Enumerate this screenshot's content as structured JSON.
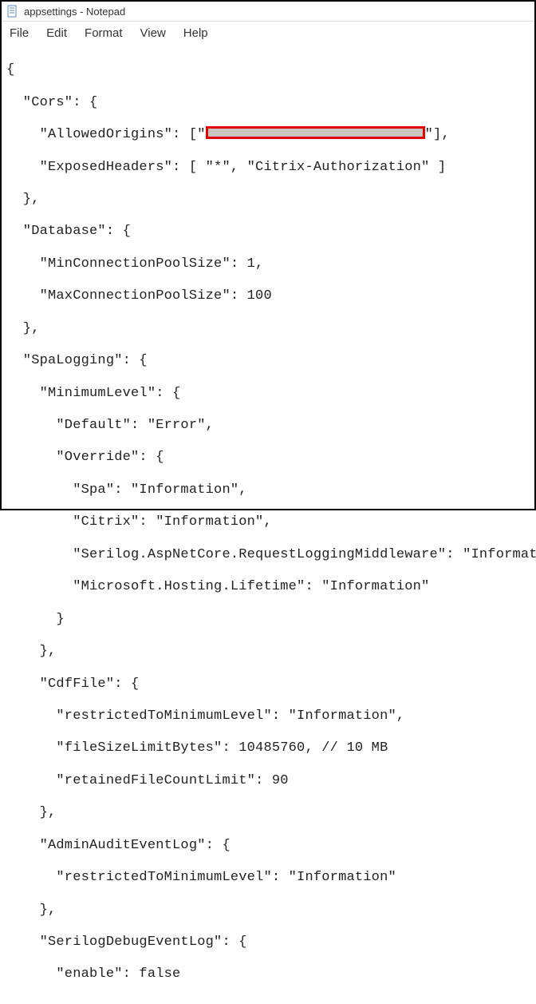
{
  "window": {
    "title": "appsettings - Notepad"
  },
  "menu": {
    "file": "File",
    "edit": "Edit",
    "format": "Format",
    "view": "View",
    "help": "Help"
  },
  "code": {
    "l0": "{",
    "l1": "  \"Cors\": {",
    "l2a": "    \"AllowedOrigins\": [\"",
    "l2b": "\"],",
    "l3": "    \"ExposedHeaders\": [ \"*\", \"Citrix-Authorization\" ]",
    "l4": "  },",
    "l5": "  \"Database\": {",
    "l6": "    \"MinConnectionPoolSize\": 1,",
    "l7": "    \"MaxConnectionPoolSize\": 100",
    "l8": "  },",
    "l9": "  \"SpaLogging\": {",
    "l10": "    \"MinimumLevel\": {",
    "l11": "      \"Default\": \"Error\",",
    "l12": "      \"Override\": {",
    "l13": "        \"Spa\": \"Information\",",
    "l14": "        \"Citrix\": \"Information\",",
    "l15": "        \"Serilog.AspNetCore.RequestLoggingMiddleware\": \"Information\",",
    "l16": "        \"Microsoft.Hosting.Lifetime\": \"Information\"",
    "l17": "      }",
    "l18": "    },",
    "l19": "    \"CdfFile\": {",
    "l20": "      \"restrictedToMinimumLevel\": \"Information\",",
    "l21": "      \"fileSizeLimitBytes\": 10485760, // 10 MB",
    "l22": "      \"retainedFileCountLimit\": 90",
    "l23": "    },",
    "l24": "    \"AdminAuditEventLog\": {",
    "l25": "      \"restrictedToMinimumLevel\": \"Information\"",
    "l26": "    },",
    "l27": "    \"SerilogDebugEventLog\": {",
    "l28": "      \"enable\": false"
  }
}
